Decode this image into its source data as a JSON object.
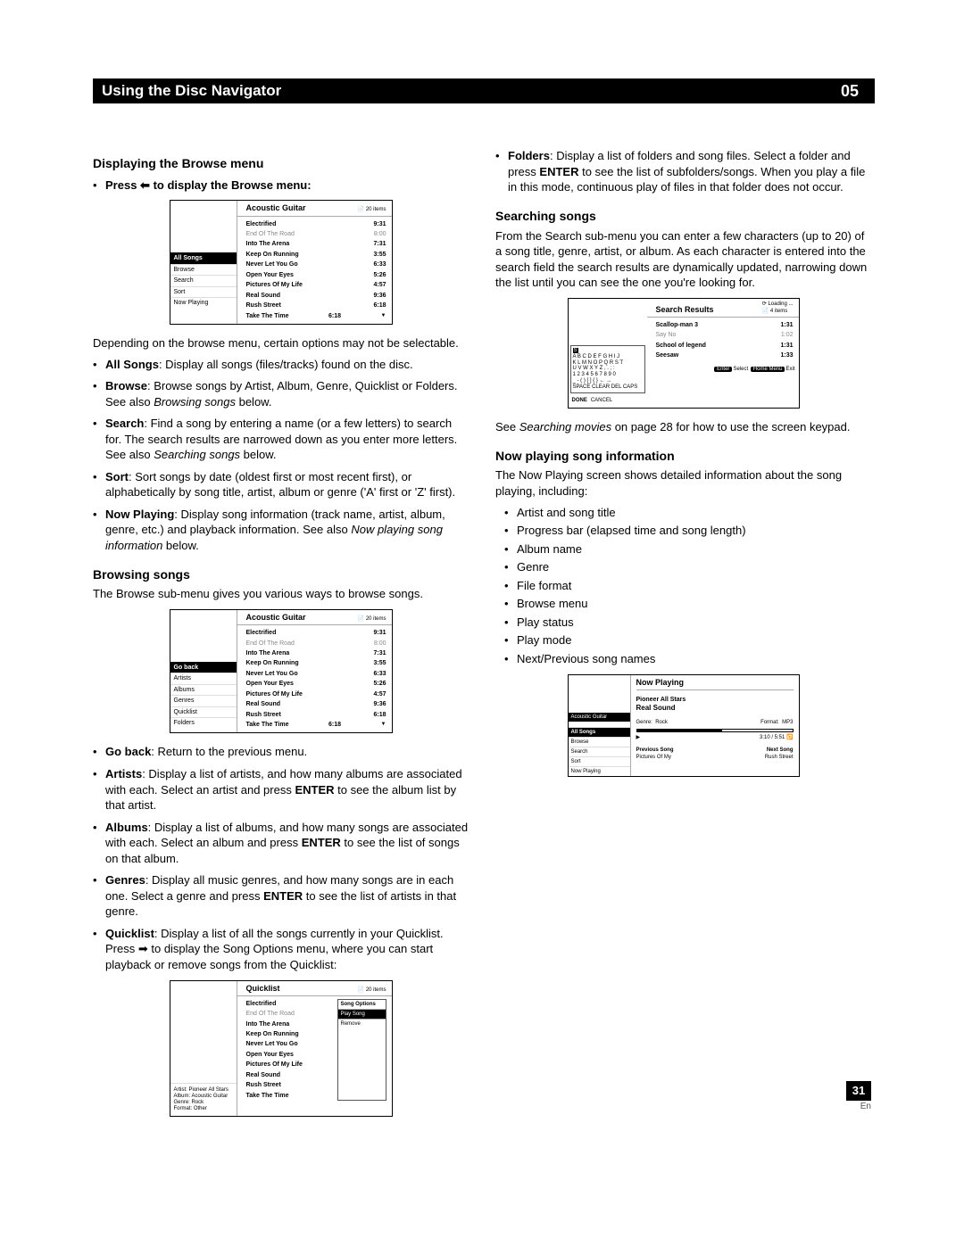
{
  "header": {
    "title": "Using the Disc Navigator",
    "chapter": "05"
  },
  "footer": {
    "page": "31",
    "lang": "En"
  },
  "left": {
    "h_display": "Displaying the Browse menu",
    "press_line_a": "Press ",
    "press_line_b": " to display the Browse menu:",
    "depending": "Depending on the browse menu, certain options may not be selectable.",
    "items": {
      "allsongs_b": "All Songs",
      "allsongs_t": ": Display all songs (files/tracks) found on the disc.",
      "browse_b": "Browse",
      "browse_t_a": ": Browse songs by Artist, Album, Genre, Quicklist or Folders. See also ",
      "browse_t_i": "Browsing songs",
      "browse_t_c": " below.",
      "search_b": "Search",
      "search_t_a": ": Find a song by entering a name (or a few letters) to search for. The search results are narrowed down as you enter more letters. See also ",
      "search_t_i": "Searching songs",
      "search_t_c": " below.",
      "sort_b": "Sort",
      "sort_t": ": Sort songs by date (oldest first or most recent first), or alphabetically by song title, artist, album or genre ('A' first or 'Z' first).",
      "nowp_b": "Now Playing",
      "nowp_t_a": ": Display song information (track name, artist, album, genre, etc.) and playback information. See also ",
      "nowp_t_i": "Now playing song information",
      "nowp_t_c": " below."
    },
    "h_browse": "Browsing songs",
    "browse_intro": "The Browse sub-menu gives you various ways to browse songs.",
    "browse_items": {
      "goback_b": "Go back",
      "goback_t": ": Return to the previous menu.",
      "artists_b": "Artists",
      "artists_t_a": ": Display a list of artists, and how many albums are associated with each. Select an artist and press ",
      "artists_t_b": "ENTER",
      "artists_t_c": " to see the album list by that artist.",
      "albums_b": "Albums",
      "albums_t_a": ": Display a list of albums, and how many songs are associated with each. Select an album and press ",
      "albums_t_b": "ENTER",
      "albums_t_c": " to see the list of songs on that album.",
      "genres_b": "Genres",
      "genres_t_a": ": Display all music genres, and how many songs are in each one. Select a genre and press ",
      "genres_t_b": "ENTER",
      "genres_t_c": " to see the list of artists in that genre.",
      "quicklist_b": "Quicklist",
      "quicklist_t_a": ": Display a list of all the songs currently in your Quicklist. Press ",
      "quicklist_t_b": " to display the Song Options menu, where you can start playback or remove songs from the Quicklist:"
    }
  },
  "right": {
    "folders_b": "Folders",
    "folders_t_a": ": Display a list of folders and song files. Select a folder and press ",
    "folders_t_b": "ENTER",
    "folders_t_c": " to see the list of subfolders/songs. When you play a file in this mode, continuous play of files in that folder does not occur.",
    "h_search": "Searching songs",
    "search_intro": "From the Search sub-menu you can enter a few characters (up to 20) of a song title, genre, artist, or album. As each character is entered into the search field the search results are dynamically updated, narrowing down the list until you can see the one you're looking for.",
    "search_ref_a": "See ",
    "search_ref_i": "Searching movies",
    "search_ref_b": " on page 28 for how to use the screen keypad.",
    "h_nowp": "Now playing song information",
    "nowp_intro": "The Now Playing screen shows detailed information about the song playing, including:",
    "nowp_list": {
      "a": "Artist and song title",
      "b": "Progress bar (elapsed time and song length)",
      "c": "Album name",
      "d": "Genre",
      "e": "File format",
      "f": "Browse menu",
      "g": "Play status",
      "h": "Play mode",
      "i": "Next/Previous song names"
    }
  },
  "shot_common": {
    "count20": "20 items",
    "album_title": "Acoustic Guitar",
    "songs": [
      {
        "name": "Electrified",
        "time": "9:31"
      },
      {
        "name": "End Of The Road",
        "time": "8:00"
      },
      {
        "name": "Into The Arena",
        "time": "7:31"
      },
      {
        "name": "Keep On Running",
        "time": "3:55"
      },
      {
        "name": "Never Let You Go",
        "time": "6:33"
      },
      {
        "name": "Open Your Eyes",
        "time": "5:26"
      },
      {
        "name": "Pictures Of My Life",
        "time": "4:57"
      },
      {
        "name": "Real Sound",
        "time": "9:36"
      },
      {
        "name": "Rush Street",
        "time": "6:18"
      },
      {
        "name": "Take The Time",
        "time": "6:18"
      }
    ],
    "side_menu1": {
      "allsongs": "All Songs",
      "browse": "Browse",
      "search": "Search",
      "sort": "Sort",
      "nowp": "Now Playing"
    },
    "side_menu2": {
      "goback": "Go back",
      "artists": "Artists",
      "albums": "Albums",
      "genres": "Genres",
      "quicklist": "Quicklist",
      "folders": "Folders"
    }
  },
  "shot_quicklist": {
    "title": "Quicklist",
    "count": "20 items",
    "info_artist": "Artist: Pioneer All Stars",
    "info_album": "Album: Acoustic Guitar",
    "info_genre": "Genre: Rock",
    "info_format": "Format: Other",
    "opt_hdr": "Song Options",
    "opt_play": "Play Song",
    "opt_remove": "Remove"
  },
  "shot_search": {
    "title": "Search Results",
    "loading": "Loading ...",
    "count": "4  items",
    "rows": [
      {
        "name": "Scallop-man 3",
        "time": "1:31"
      },
      {
        "name": "Say No",
        "time": "1:02"
      },
      {
        "name": "School of legend",
        "time": "1:31"
      },
      {
        "name": "Seesaw",
        "time": "1:33"
      }
    ],
    "kp_sel": "S",
    "kp_r1": "A B C D E F G H I J",
    "kp_r2": "K L M N O P Q R S T",
    "kp_r3": "U V W X Y Z , . ; :",
    "kp_r4": "1 2 3 4 5 6 7 8 9 0",
    "kp_r5": "_ - (  ) [  ] { } ← →",
    "kp_r6": "SPACE   CLEAR  DEL  CAPS",
    "done": "DONE",
    "cancel": "CANCEL",
    "hint_enter": "Enter",
    "hint_select": "Select",
    "hint_home": "Home Menu",
    "hint_exit": "Exit"
  },
  "shot_nowp": {
    "title": "Now Playing",
    "tag": "Acoustic Guitar",
    "artist": "Pioneer All Stars",
    "song": "Real Sound",
    "genre_lbl": "Genre:",
    "genre_val": "Rock",
    "fmt_lbl": "Format:",
    "fmt_val": "MP3",
    "elapsed": "3:10 / 5:51",
    "prev_lbl": "Previous Song",
    "prev_val": "Pictures Of My",
    "next_lbl": "Next Song",
    "next_val": "Rush Street",
    "play_icon": "▶"
  }
}
